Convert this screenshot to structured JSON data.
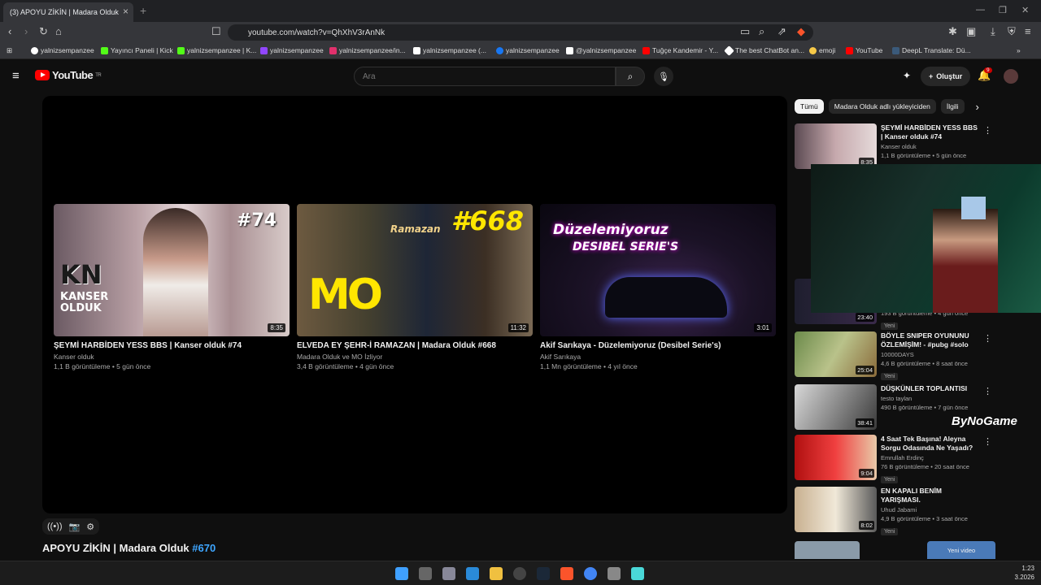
{
  "browser": {
    "tab_title": "(3) APOYU ZİKİN | Madara Olduk",
    "url": "youtube.com/watch?v=QhXhV3rAnNk",
    "bookmarks": [
      {
        "label": "yalnizsempanzee",
        "color": "#fff"
      },
      {
        "label": "Yayıncı Paneli | Kick",
        "color": "#53fc18"
      },
      {
        "label": "yalnizsempanzee | K...",
        "color": "#53fc18"
      },
      {
        "label": "yalnizsempanzee",
        "color": "#9146ff"
      },
      {
        "label": "yalnizsempanzee/in...",
        "color": "#e1306c"
      },
      {
        "label": "yalnizsempanzee (...",
        "color": "#fff"
      },
      {
        "label": "yalnizsempanzee",
        "color": "#1877f2"
      },
      {
        "label": "@yalnizsempanzee",
        "color": "#fff"
      },
      {
        "label": "Tuğçe Kandemir - Y...",
        "color": "#f00"
      },
      {
        "label": "The best ChatBot an...",
        "color": "#fff"
      },
      {
        "label": "emoji",
        "color": "#f7c948"
      },
      {
        "label": "YouTube",
        "color": "#f00"
      },
      {
        "label": "DeepL Translate: Dü...",
        "color": "#0f2b46"
      }
    ]
  },
  "youtube": {
    "logo_text": "YouTube",
    "logo_country": "TR",
    "search_placeholder": "Ara",
    "create_label": "Oluştur",
    "notif_count": "9"
  },
  "player": {
    "endcards": [
      {
        "title": "ŞEYMİ HARBİDEN YESS BBS | Kanser olduk #74",
        "channel": "Kanser olduk",
        "meta": "1,1 B görüntüleme • 5 gün önce",
        "duration": "8:35",
        "overlay": "#74",
        "logo": "KANSER OLDUK"
      },
      {
        "title": "ELVEDA EY ŞEHR-İ RAMAZAN | Madara Olduk #668",
        "channel": "Madara Olduk ve MO İzliyor",
        "meta": "3,4 B görüntüleme • 4 gün önce",
        "duration": "11:32",
        "overlay": "#668",
        "logo": "Ramazan"
      },
      {
        "title": "Akif Sarıkaya - Düzelemiyoruz (Desibel Serie's)",
        "channel": "Akif Sarıkaya",
        "meta": "1,1 Mn görüntüleme • 4 yıl önce",
        "duration": "3:01",
        "overlay": "Düzelemiyoruz",
        "logo": "DESIBEL SERIE'S"
      }
    ]
  },
  "video": {
    "title": "APOYU ZİKİN | Madara Olduk",
    "hashtag": "#670"
  },
  "sidebar": {
    "chips": [
      "Tümü",
      "Madara Olduk adlı yükleyiciden",
      "İlgili"
    ],
    "recs": [
      {
        "title": "ŞEYMİ HARBİDEN YESS BBS | Kanser olduk #74",
        "channel": "Kanser olduk",
        "meta": "1,1 B görüntüleme • 5 gün önce",
        "duration": "8:35",
        "badge": ""
      },
      {
        "title": "",
        "channel": "",
        "meta": "193 B görüntüleme • 4 gün önce",
        "duration": "23:40",
        "badge": "Yeni"
      },
      {
        "title": "BÖYLE SNIPER OYUNUNU ÖZLEMİŞİM! - #pubg #solo",
        "channel": "10000DAYS",
        "meta": "4,6 B görüntüleme • 8 saat önce",
        "duration": "25:04",
        "badge": "Yeni"
      },
      {
        "title": "DÜŞKÜNLER TOPLANTISI",
        "channel": "testo taylan",
        "meta": "490 B görüntüleme • 7 gün önce",
        "duration": "38:41",
        "badge": ""
      },
      {
        "title": "4 Saat Tek Başına! Aleyna Sorgu Odasında Ne Yaşadı?",
        "channel": "Emrullah Erdinç",
        "meta": "76 B görüntüleme • 20 saat önce",
        "duration": "9:04",
        "badge": "Yeni"
      },
      {
        "title": "EN KAPALI BENİM YARIŞMASI.",
        "channel": "Uhud Jabami",
        "meta": "4,9 B görüntüleme • 3 saat önce",
        "duration": "8:02",
        "badge": "Yeni"
      }
    ],
    "new_video_label": "Yeni video"
  },
  "overlay": {
    "sponsor": "ByNoGame"
  },
  "taskbar": {
    "time": "1:23",
    "date": "3.2026"
  }
}
